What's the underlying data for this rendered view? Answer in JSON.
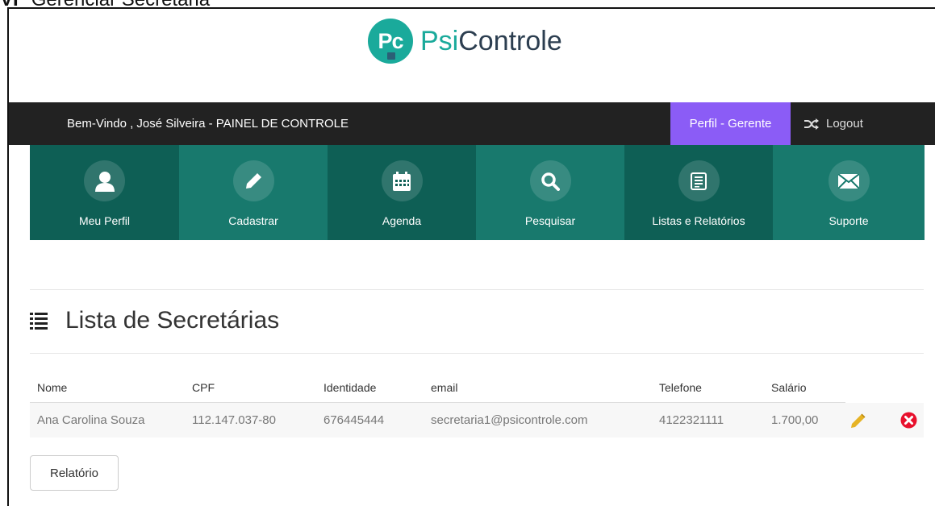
{
  "doc_heading": {
    "number": "VI",
    "text": "Gerenciar Secretária"
  },
  "logo": {
    "badge": "Pc",
    "brand_prefix": "Psi",
    "brand_suffix": "Controle"
  },
  "topnav": {
    "welcome": "Bem-Vindo , José  Silveira - PAINEL DE CONTROLE",
    "profile": "Perfil - Gerente",
    "logout": "Logout",
    "profile_color": "#8b5cf6"
  },
  "tiles": [
    {
      "label": "Meu Perfil",
      "icon": "user-icon"
    },
    {
      "label": "Cadastrar",
      "icon": "pencil-icon"
    },
    {
      "label": "Agenda",
      "icon": "calendar-icon"
    },
    {
      "label": "Pesquisar",
      "icon": "search-icon"
    },
    {
      "label": "Listas e Relatórios",
      "icon": "list-icon"
    },
    {
      "label": "Suporte",
      "icon": "envelope-icon"
    }
  ],
  "list": {
    "title": "Lista de Secretárias",
    "columns": [
      "Nome",
      "CPF",
      "Identidade",
      "email",
      "Telefone",
      "Salário"
    ],
    "rows": [
      {
        "nome": "Ana Carolina Souza",
        "cpf": "112.147.037-80",
        "identidade": "676445444",
        "email": "secretaria1@psicontrole.com",
        "telefone": "4122321111",
        "salario": "1.700,00"
      }
    ]
  },
  "report_button": "Relatório",
  "colors": {
    "teal_dark": "#0e5f55",
    "teal_light": "#18796d",
    "brand": "#1aaa9b",
    "delete": "#e8112d",
    "edit": "#e6b325"
  }
}
